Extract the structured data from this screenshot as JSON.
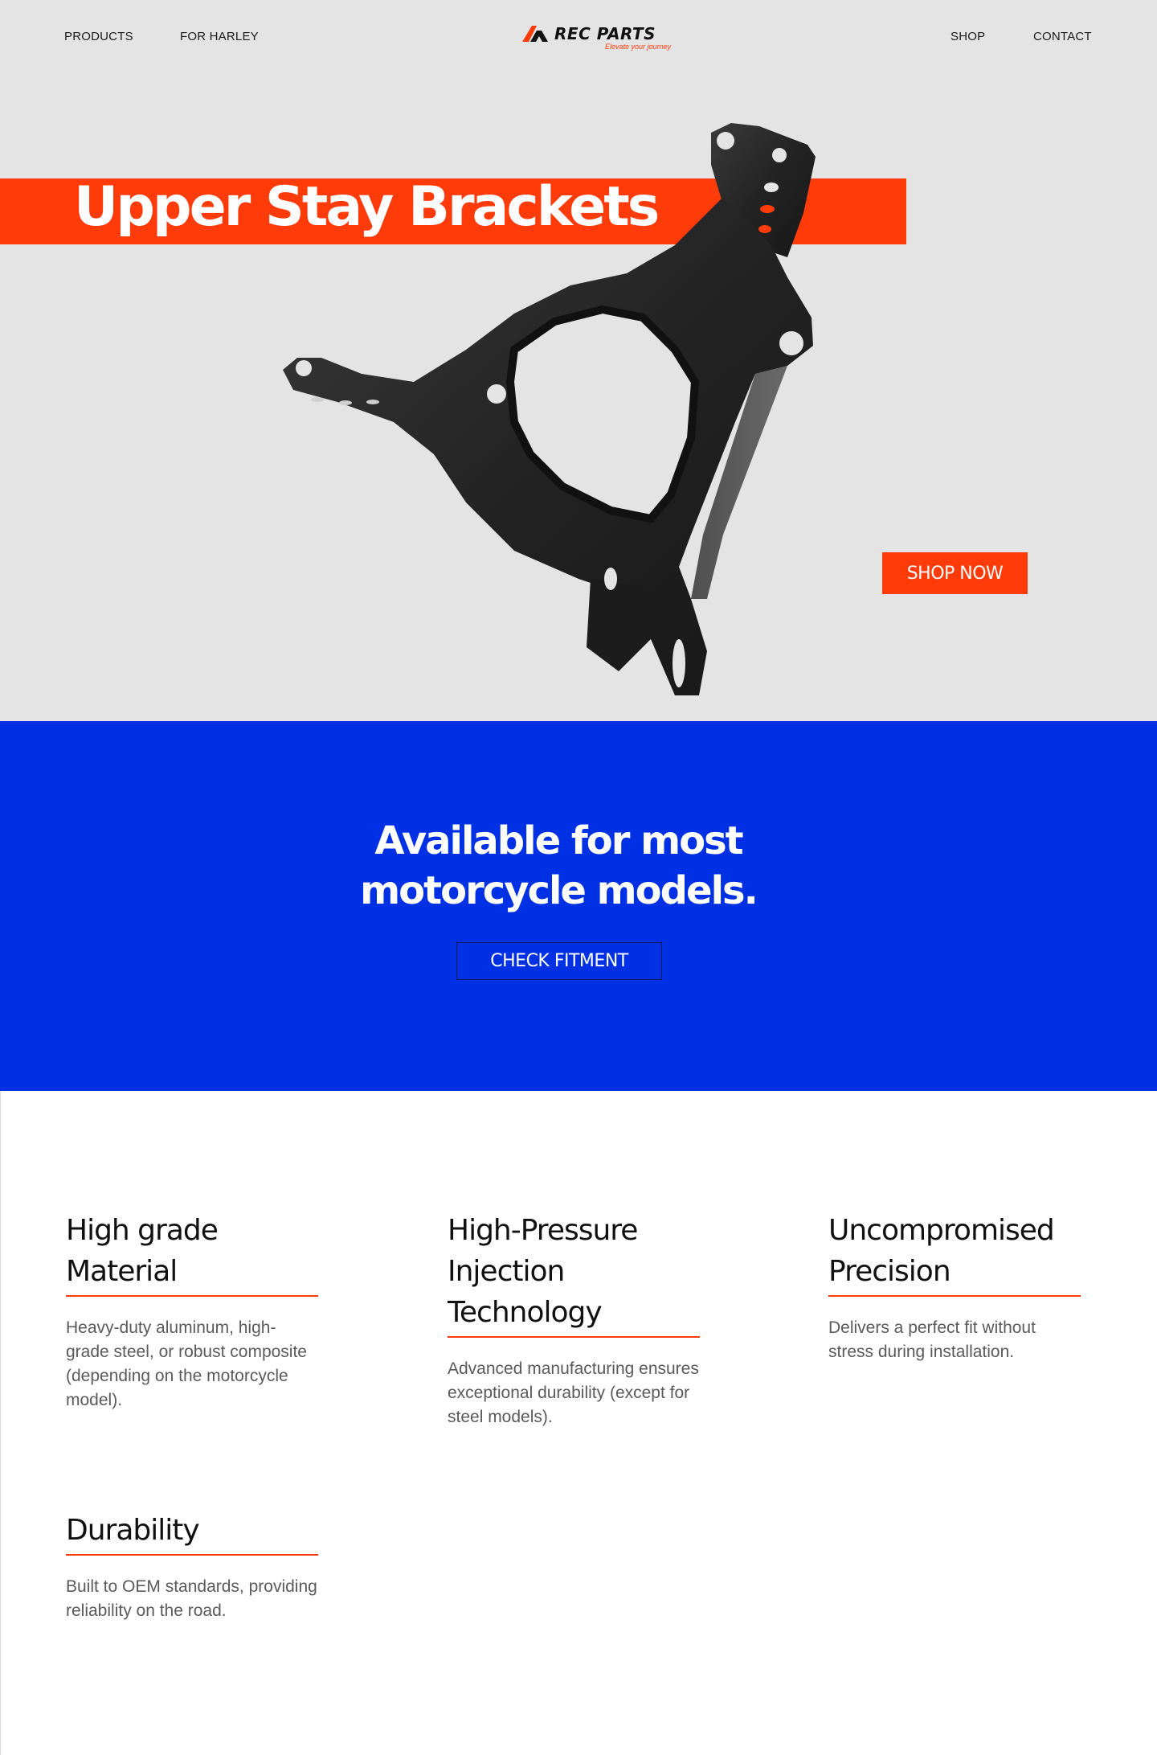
{
  "nav": {
    "products": "PRODUCTS",
    "for_harley": "FOR HARLEY",
    "shop": "SHOP",
    "contact": "CONTACT"
  },
  "logo": {
    "name": "REC PARTS",
    "tagline": "Elevate your journey"
  },
  "hero": {
    "title": "Upper Stay Brackets",
    "cta": "SHOP NOW",
    "image": "upper-stay-bracket-product-photo"
  },
  "fitment": {
    "title_line1": "Available for most",
    "title_line2": "motorcycle models.",
    "cta": "CHECK FITMENT"
  },
  "features": [
    {
      "title": "High grade Material",
      "text": "Heavy-duty aluminum,  high-grade steel, or robust composite (depending on the motorcycle  model)."
    },
    {
      "title": "High-Pressure Injection Technology",
      "text": "Advanced  manufacturing ensures exceptional durability (except for steel  models)."
    },
    {
      "title": "Uncompromised Precision",
      "text": "Delivers a perfect fit  without stress during installation."
    },
    {
      "title": "Durability",
      "text": "Built to OEM standards, providing  reliability on the road."
    }
  ],
  "colors": {
    "accent": "#ff3b0a",
    "blue": "#0030e3",
    "hero_bg": "#e4e4e4"
  }
}
